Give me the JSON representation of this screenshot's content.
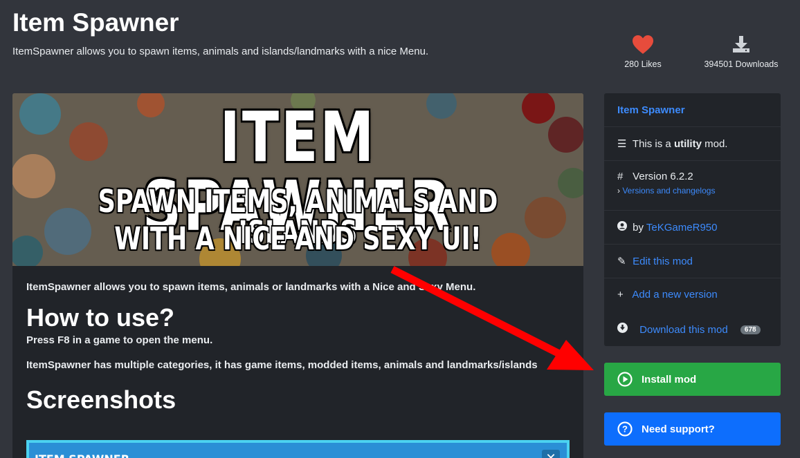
{
  "header": {
    "title": "Item Spawner",
    "subtitle": "ItemSpawner allows you to spawn items, animals and islands/landmarks with a nice Menu."
  },
  "stats": {
    "likes": "280 Likes",
    "likes_icon": "heart-icon",
    "downloads": "394501 Downloads",
    "downloads_icon": "download-icon"
  },
  "banner": {
    "line1": "ITEM SPAWNER",
    "line2": "SPAWN ITEMS, ANIMALS AND ISLANDS",
    "line3": "WITH A NICE AND SEXY UI!"
  },
  "content": {
    "description": "ItemSpawner allows you to spawn items, animals or landmarks with a Nice and Sexy Menu.",
    "how_heading": "How to use?",
    "how_text_1": "Press F8 in a game to open the menu.",
    "how_text_2": "ItemSpawner has multiple categories, it has game items, modded items, animals and landmarks/islands",
    "screens_heading": "Screenshots",
    "screenshot_title": "ITEM SPAWNER",
    "screenshot_close": "✕"
  },
  "sidebar": {
    "title": "Item Spawner",
    "type_prefix": "This is a",
    "type_value": "utility",
    "type_suffix": "mod.",
    "version_label": "Version 6.2.2",
    "version_link": "Versions and changelogs",
    "author_prefix": "by",
    "author": "TeKGameR950",
    "edit": "Edit this mod",
    "add": "Add a new version",
    "download": "Download this mod",
    "download_count": "678"
  },
  "buttons": {
    "install": "Install mod",
    "support": "Need support?"
  },
  "colors": {
    "background": "#32353c",
    "panel": "#212429",
    "link": "#3d8bfd",
    "install": "#28a745",
    "support": "#0d6efd",
    "heart": "#e74c3c",
    "arrow": "#ff0000"
  }
}
